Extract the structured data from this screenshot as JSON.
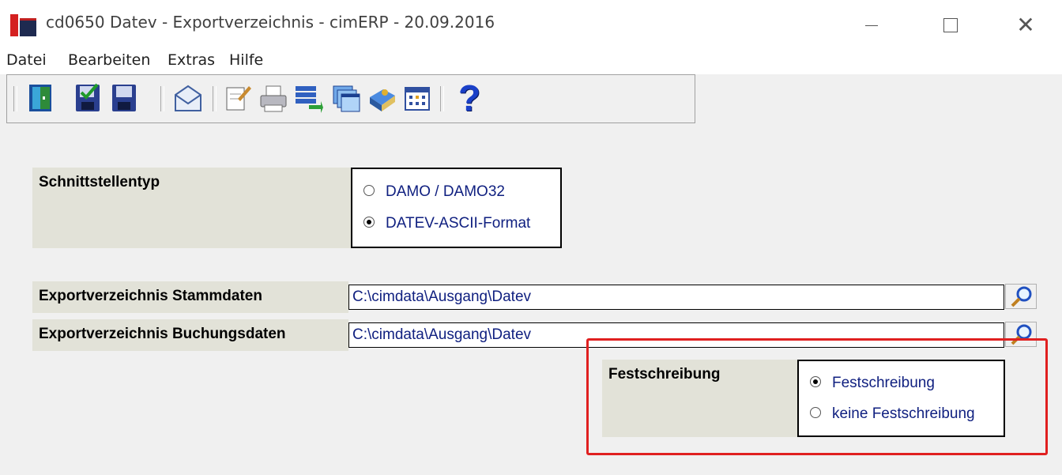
{
  "window": {
    "title": "cd0650 Datev - Exportverzeichnis - cimERP - 20.09.2016"
  },
  "menu": {
    "items": [
      "Datei",
      "Bearbeiten",
      "Extras",
      "Hilfe"
    ]
  },
  "toolbar": {
    "icons": [
      "exit-door-icon",
      "save-check-icon",
      "save-icon",
      "mail-icon",
      "edit-note-icon",
      "print-icon",
      "list-transfer-icon",
      "windows-icon",
      "book-icon",
      "calendar-grid-icon",
      "help-icon"
    ],
    "help_glyph": "?"
  },
  "interface_type": {
    "label": "Schnittstellentyp",
    "options": [
      "DAMO / DAMO32",
      "DATEV-ASCII-Format"
    ],
    "selected": "DATEV-ASCII-Format"
  },
  "export_master": {
    "label": "Exportverzeichnis Stammdaten",
    "value": "C:\\cimdata\\Ausgang\\Datev"
  },
  "export_booking": {
    "label": "Exportverzeichnis Buchungsdaten",
    "value": "C:\\cimdata\\Ausgang\\Datev"
  },
  "fixation": {
    "label": "Festschreibung",
    "options": [
      "Festschreibung",
      "keine Festschreibung"
    ],
    "selected": "Festschreibung"
  },
  "colors": {
    "highlight": "#e02020",
    "option_text": "#102080",
    "label_bg": "#e2e2d8"
  }
}
